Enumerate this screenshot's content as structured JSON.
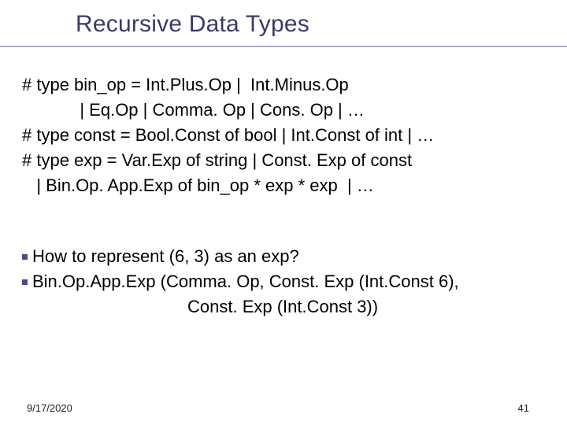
{
  "title": "Recursive Data Types",
  "code": {
    "l1": "# type bin_op = Int.Plus.Op |  Int.Minus.Op",
    "l2": "            | Eq.Op | Comma. Op | Cons. Op | …",
    "l3": "# type const = Bool.Const of bool | Int.Const of int | …",
    "l4": "# type exp = Var.Exp of string | Const. Exp of const",
    "l5": "   | Bin.Op. App.Exp of bin_op * exp * exp  | …"
  },
  "bullets": {
    "b1": "How to represent (6, 3) as an exp?",
    "b2": "Bin.Op.App.Exp (Comma. Op, Const. Exp (Int.Const 6),",
    "b2_cont": "Const. Exp (Int.Const 3))"
  },
  "footer": {
    "date": "9/17/2020",
    "page": "41"
  }
}
